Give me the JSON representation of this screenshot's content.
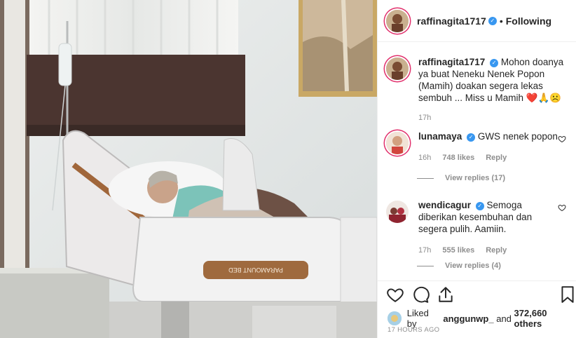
{
  "post": {
    "author": "raffinagita1717",
    "follow_status": "Following",
    "dot": "•",
    "verified_mark": "✓"
  },
  "caption": {
    "author": "raffinagita1717",
    "text": "Mohon doanya ya buat Neneku Nenek Popon (Mamih) doakan segera lekas sembuh ... Miss u Mamih",
    "emoji": "❤️🙏☹️",
    "time": "17h"
  },
  "comments": [
    {
      "author": "lunamaya",
      "text": "GWS nenek popon",
      "time": "16h",
      "likes": "748 likes",
      "reply": "Reply",
      "view_replies": "View replies (17)"
    },
    {
      "author": "wendicagur",
      "text": "Semoga diberikan kesembuhan dan segera pulih. Aamiin.",
      "time": "17h",
      "likes": "555 likes",
      "reply": "Reply",
      "view_replies": "View replies (4)"
    }
  ],
  "likes": {
    "prefix": "Liked by",
    "user": "anggunwp_",
    "joiner": "and",
    "count": "372,660 others"
  },
  "timestamp": "17 HOURS AGO",
  "photo_text": {
    "bed_brand": "PARAMOUNT BED"
  },
  "colors": {
    "verified": "#3897f0",
    "story_ring": "#e1306c",
    "secondary_text": "#8e8e8e",
    "primary_text": "#262626"
  },
  "icons": {
    "like": "heart-outline-icon",
    "comment": "comment-bubble-icon",
    "share": "share-paper-plane-icon",
    "save": "bookmark-icon",
    "comment_like": "small-heart-icon"
  }
}
